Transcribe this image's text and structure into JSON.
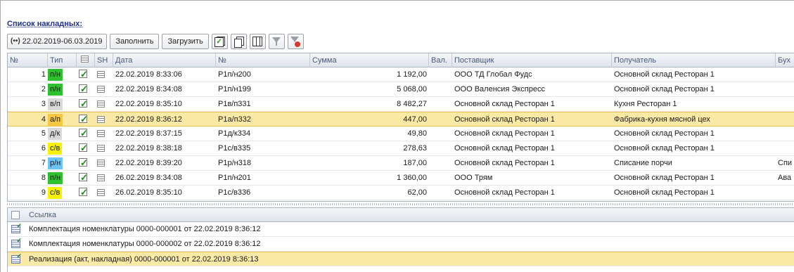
{
  "title": "Список накладных:",
  "toolbar": {
    "period": "22.02.2019-06.03.2019",
    "fill_label": "Заполнить",
    "load_label": "Загрузить"
  },
  "columns": {
    "num": "№",
    "type": "Тип",
    "sh": "SH",
    "date": "Дата",
    "docnum": "№",
    "sum": "Сумма",
    "cur": "Вал.",
    "supplier": "Поставщик",
    "receiver": "Получатель",
    "acc": "Бух"
  },
  "type_colors": {
    "п/н": "#2ec02e",
    "в/п": "#d9d9d9",
    "а/п": "#f4c842",
    "д/к": "#d9d9d9",
    "с/в": "#f7f200",
    "р/н": "#6ec3f5"
  },
  "rows": [
    {
      "n": "1",
      "type": "п/н",
      "date": "22.02.2019 8:33:06",
      "doc": "Р1п/н200",
      "sum": "1 192,00",
      "supplier": "ООО ТД Глобал Фудс",
      "receiver": "Основной склад Ресторан 1",
      "acc": ""
    },
    {
      "n": "2",
      "type": "п/н",
      "date": "22.02.2019 8:34:08",
      "doc": "Р1п/н199",
      "sum": "5 068,00",
      "supplier": "ООО Валенсия Экспресс",
      "receiver": "Основной склад Ресторан 1",
      "acc": ""
    },
    {
      "n": "3",
      "type": "в/п",
      "date": "22.02.2019 8:35:10",
      "doc": "Р1в/п331",
      "sum": "8 482,27",
      "supplier": "Основной склад Ресторан 1",
      "receiver": "Кухня Ресторан 1",
      "acc": ""
    },
    {
      "n": "4",
      "type": "а/п",
      "date": "22.02.2019 8:36:12",
      "doc": "Р1а/п332",
      "sum": "447,00",
      "supplier": "Основной склад Ресторан 1",
      "receiver": "Фабрика-кухня мясной цех",
      "acc": "",
      "selected": true
    },
    {
      "n": "5",
      "type": "д/к",
      "date": "22.02.2019 8:37:15",
      "doc": "Р1д/к334",
      "sum": "49,80",
      "supplier": "Основной склад Ресторан 1",
      "receiver": "Основной склад Ресторан 1",
      "acc": ""
    },
    {
      "n": "6",
      "type": "с/в",
      "date": "22.02.2019 8:38:18",
      "doc": "Р1с/в335",
      "sum": "278,63",
      "supplier": "Основной склад Ресторан 1",
      "receiver": "Основной склад Ресторан 1",
      "acc": ""
    },
    {
      "n": "7",
      "type": "р/н",
      "date": "22.02.2019 8:39:20",
      "doc": "Р1р/н318",
      "sum": "187,00",
      "supplier": "Основной склад Ресторан 1",
      "receiver": "Списание порчи",
      "acc": "Спи"
    },
    {
      "n": "8",
      "type": "п/н",
      "date": "26.02.2019 8:34:08",
      "doc": "Р1п/н201",
      "sum": "1 360,00",
      "supplier": "ООО Трям",
      "receiver": "Основной склад Ресторан 1",
      "acc": "Ава"
    },
    {
      "n": "9",
      "type": "с/в",
      "date": "26.02.2019 8:35:10",
      "doc": "Р1с/в336",
      "sum": "62,00",
      "supplier": "Основной склад Ресторан 1",
      "receiver": "Основной склад Ресторан 1",
      "acc": ""
    }
  ],
  "links": {
    "header": "Ссылка",
    "items": [
      {
        "text": "Комплектация номенклатуры 0000-000001 от 22.02.2019 8:36:12"
      },
      {
        "text": "Комплектация номенклатуры 0000-000002 от 22.02.2019 8:36:12"
      },
      {
        "text": "Реализация (акт, накладная) 0000-000001 от 22.02.2019 8:36:13",
        "selected": true
      }
    ]
  }
}
